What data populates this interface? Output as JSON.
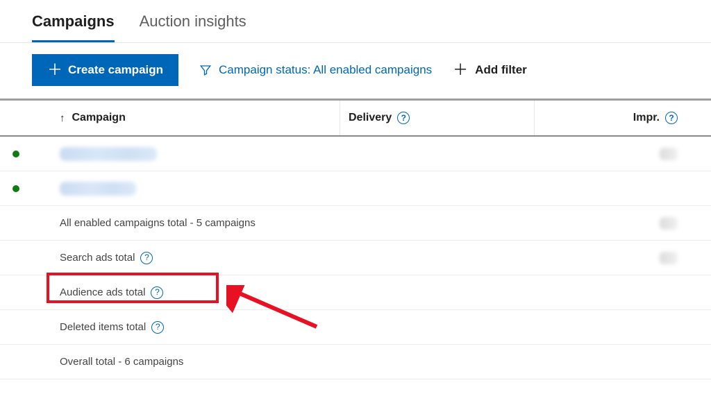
{
  "tabs": {
    "campaigns": "Campaigns",
    "auction": "Auction insights",
    "active": "campaigns"
  },
  "toolbar": {
    "create_label": "Create campaign",
    "status_label": "Campaign status: All enabled campaigns",
    "add_filter_label": "Add filter"
  },
  "columns": {
    "campaign": "Campaign",
    "delivery": "Delivery",
    "impr": "Impr."
  },
  "rows": {
    "enabled_total": "All enabled campaigns total - 5 campaigns",
    "search_total": "Search ads total",
    "audience_total": "Audience ads total",
    "deleted_total": "Deleted items total",
    "overall_total": "Overall total - 6 campaigns"
  }
}
